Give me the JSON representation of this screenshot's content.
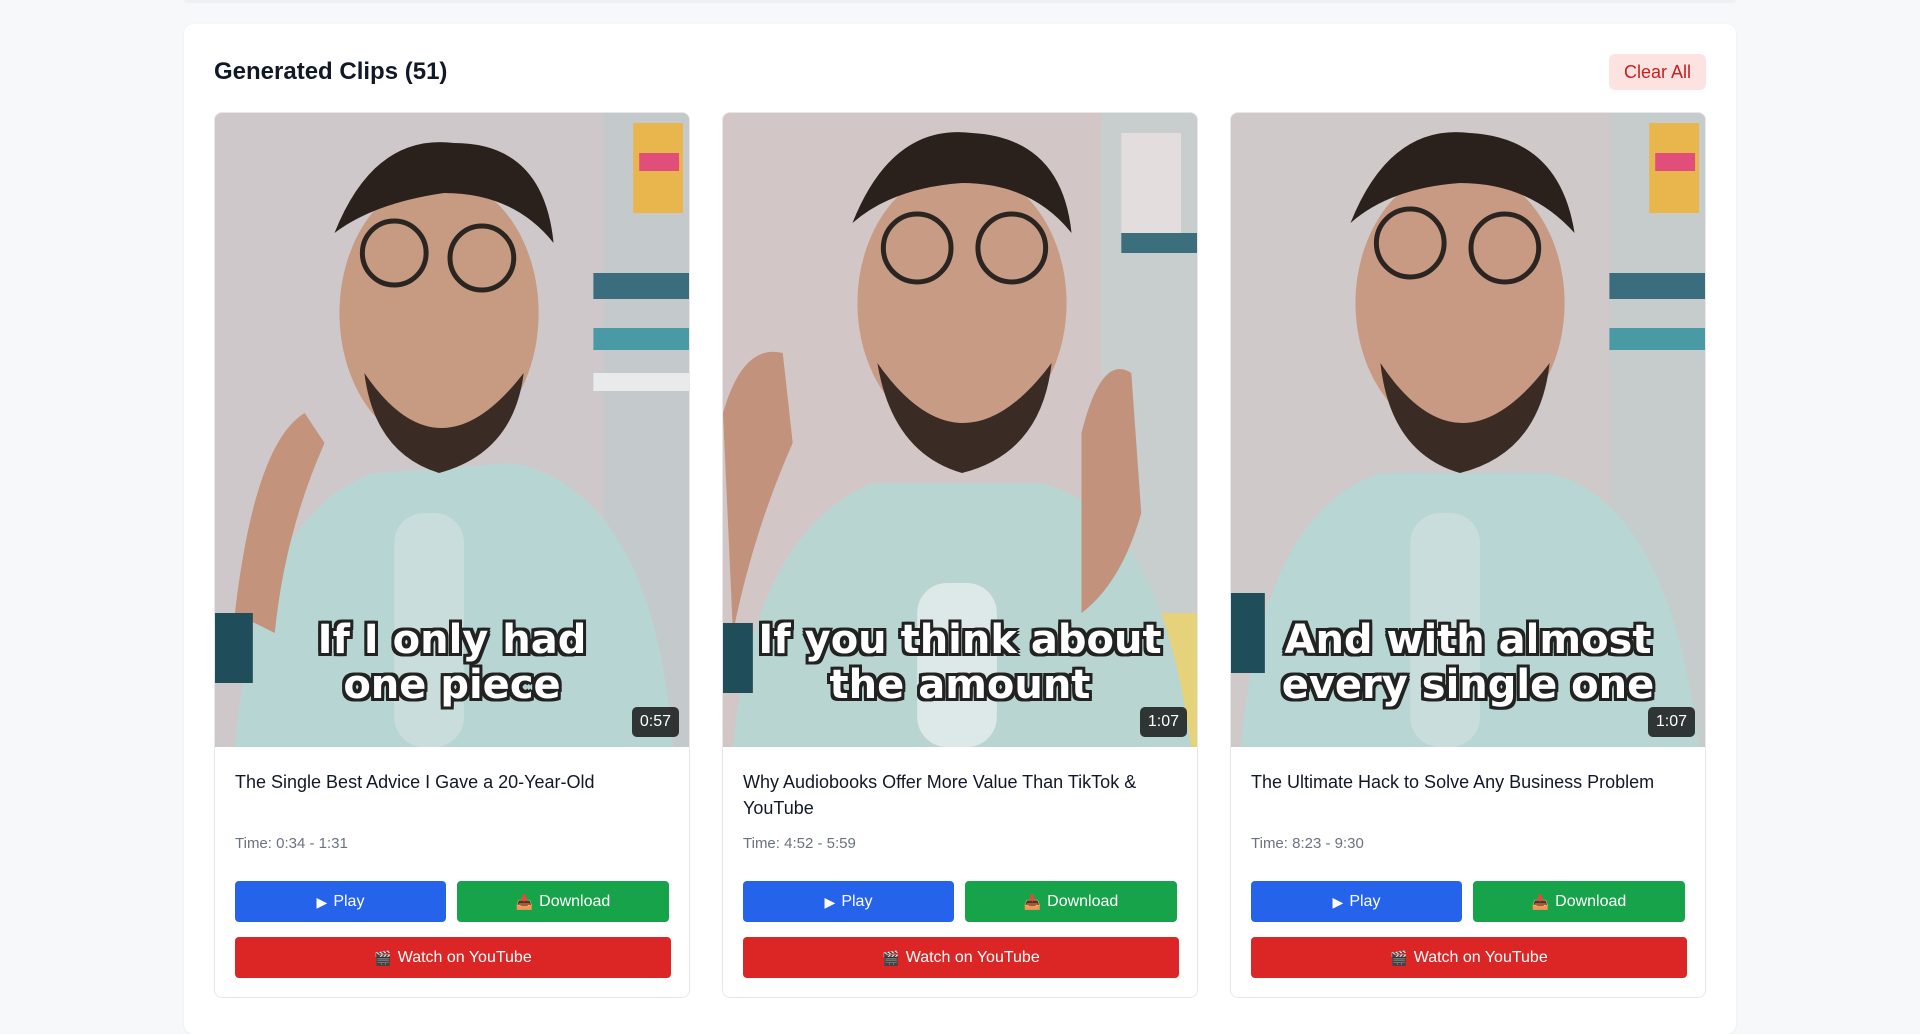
{
  "panel": {
    "title": "Generated Clips (51)",
    "clear_label": "Clear All"
  },
  "icons": {
    "play": "▶",
    "download": "📥",
    "youtube": "🎬"
  },
  "clips": [
    {
      "caption": "If I only had\none piece",
      "duration": "0:57",
      "title": "The Single Best Advice I Gave a 20-Year-Old",
      "time": "Time: 0:34 - 1:31",
      "play_label": "Play",
      "download_label": "Download",
      "youtube_label": "Watch on YouTube"
    },
    {
      "caption": "If you think about\nthe amount",
      "duration": "1:07",
      "title": "Why Audiobooks Offer More Value Than TikTok & YouTube",
      "time": "Time: 4:52 - 5:59",
      "play_label": "Play",
      "download_label": "Download",
      "youtube_label": "Watch on YouTube"
    },
    {
      "caption": "And with almost\nevery single one",
      "duration": "1:07",
      "title": "The Ultimate Hack to Solve Any Business Problem",
      "time": "Time: 8:23 - 9:30",
      "play_label": "Play",
      "download_label": "Download",
      "youtube_label": "Watch on YouTube"
    }
  ]
}
